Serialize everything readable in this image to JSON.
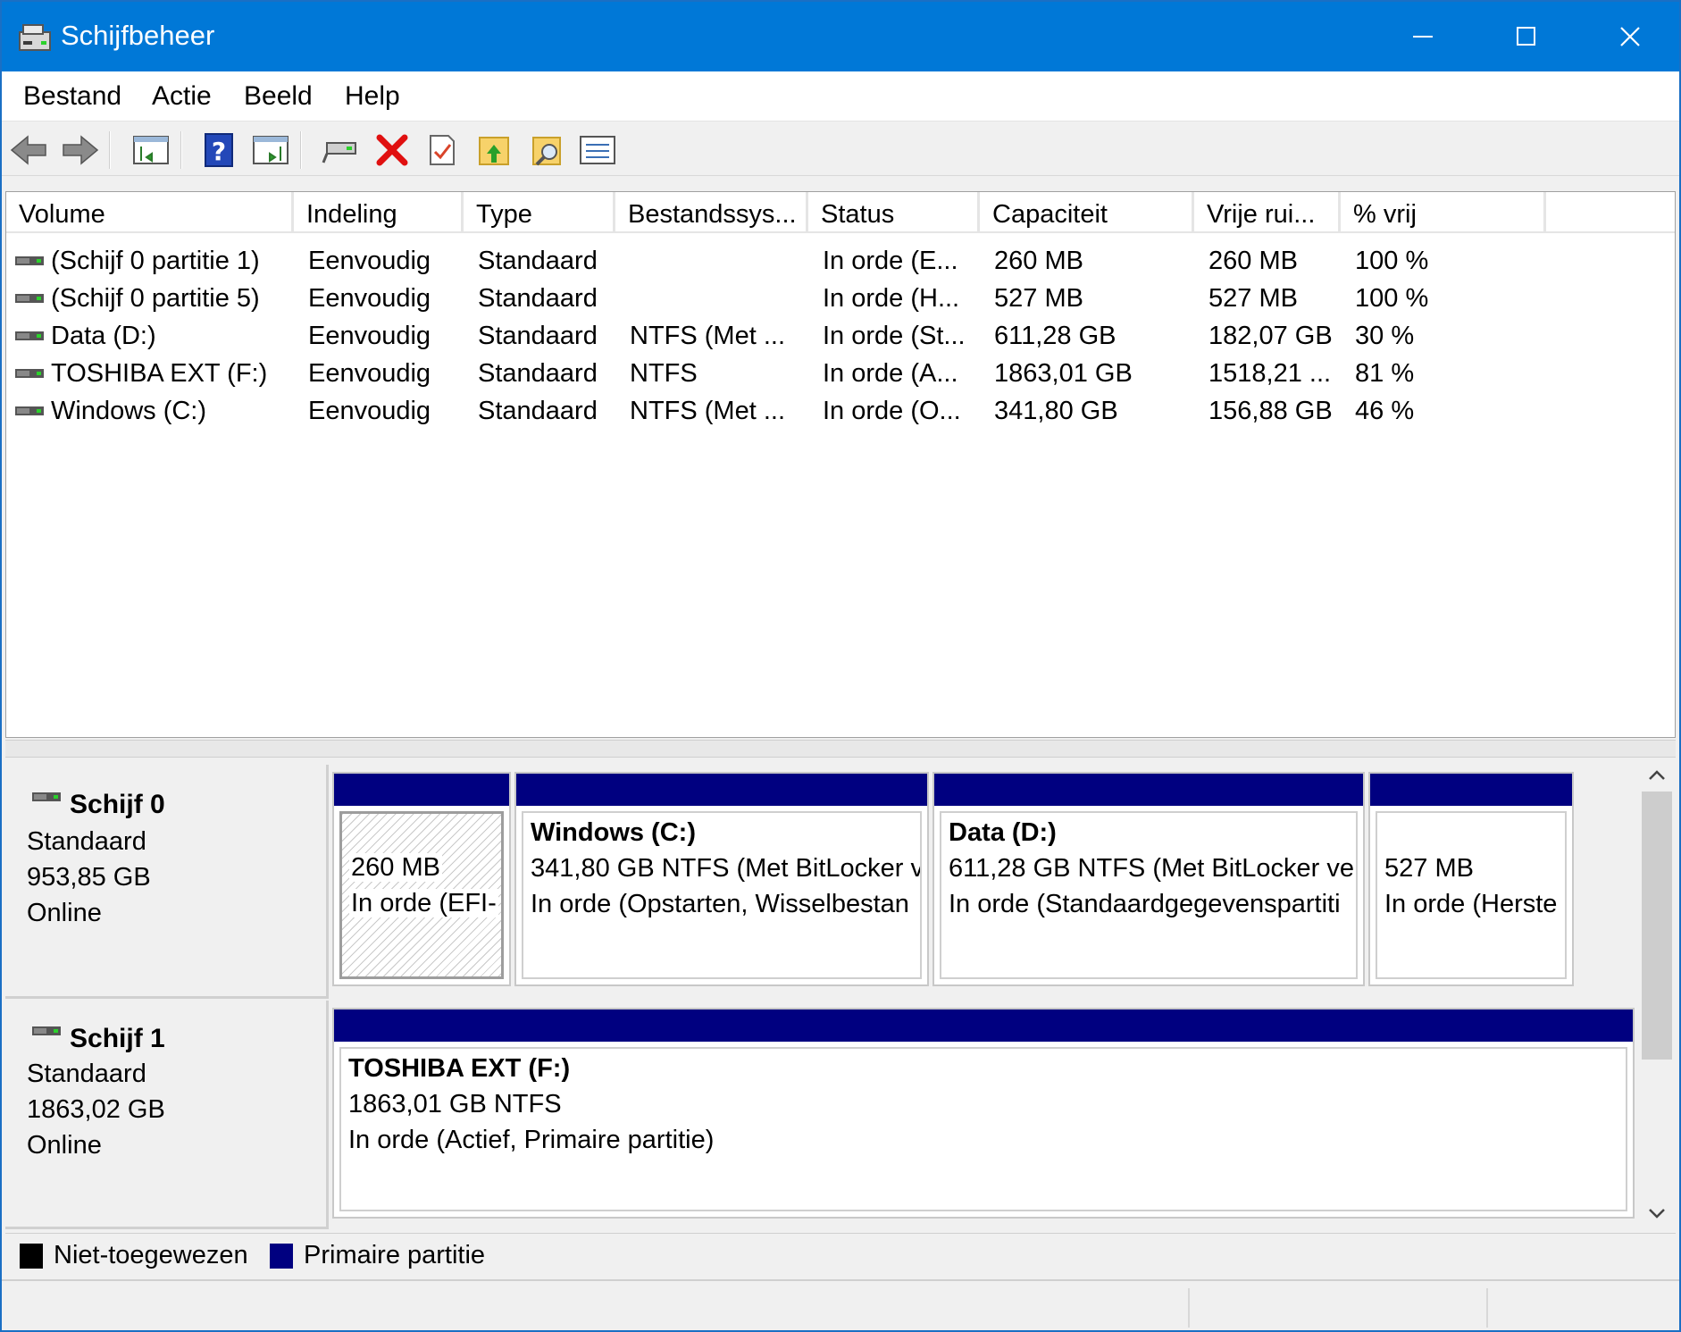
{
  "window": {
    "title": "Schijfbeheer"
  },
  "menu": [
    "Bestand",
    "Actie",
    "Beeld",
    "Help"
  ],
  "toolbar": {
    "icons": [
      "back-icon",
      "forward-icon",
      "show-hide-console-tree-icon",
      "help-icon",
      "show-hide-action-pane-icon",
      "connect-drive-icon",
      "delete-icon",
      "properties-icon",
      "folder-up-icon",
      "search-folder-icon",
      "list-view-icon"
    ]
  },
  "columns": [
    "Volume",
    "Indeling",
    "Type",
    "Bestandssys...",
    "Status",
    "Capaciteit",
    "Vrije rui...",
    "% vrij"
  ],
  "volumes": [
    {
      "volume": "(Schijf 0 partitie 1)",
      "layout": "Eenvoudig",
      "type": "Standaard",
      "fs": "",
      "status": "In orde (E...",
      "capacity": "260 MB",
      "free": "260 MB",
      "pct": "100 %"
    },
    {
      "volume": "(Schijf 0 partitie 5)",
      "layout": "Eenvoudig",
      "type": "Standaard",
      "fs": "",
      "status": "In orde (H...",
      "capacity": "527 MB",
      "free": "527 MB",
      "pct": "100 %"
    },
    {
      "volume": "Data (D:)",
      "layout": "Eenvoudig",
      "type": "Standaard",
      "fs": "NTFS (Met ...",
      "status": "In orde (St...",
      "capacity": "611,28 GB",
      "free": "182,07 GB",
      "pct": "30 %"
    },
    {
      "volume": "TOSHIBA EXT (F:)",
      "layout": "Eenvoudig",
      "type": "Standaard",
      "fs": "NTFS",
      "status": "In orde (A...",
      "capacity": "1863,01 GB",
      "free": "1518,21 ...",
      "pct": "81 %"
    },
    {
      "volume": "Windows (C:)",
      "layout": "Eenvoudig",
      "type": "Standaard",
      "fs": "NTFS (Met ...",
      "status": "In orde (O...",
      "capacity": "341,80 GB",
      "free": "156,88 GB",
      "pct": "46 %"
    }
  ],
  "disks": [
    {
      "name": "Schijf 0",
      "type": "Standaard",
      "size": "953,85 GB",
      "state": "Online",
      "partitions": [
        {
          "title": "",
          "line1": "260 MB",
          "line2": "In orde (EFI-"
        },
        {
          "title": "Windows  (C:)",
          "line1": "341,80 GB NTFS (Met BitLocker v",
          "line2": "In orde (Opstarten, Wisselbestan"
        },
        {
          "title": "Data  (D:)",
          "line1": "611,28 GB NTFS (Met BitLocker ve",
          "line2": "In orde (Standaardgegevenspartiti"
        },
        {
          "title": "",
          "line1": "527 MB",
          "line2": "In orde (Herste"
        }
      ]
    },
    {
      "name": "Schijf 1",
      "type": "Standaard",
      "size": "1863,02 GB",
      "state": "Online",
      "partitions": [
        {
          "title": "TOSHIBA EXT  (F:)",
          "line1": "1863,01 GB NTFS",
          "line2": "In orde (Actief, Primaire partitie)"
        }
      ]
    }
  ],
  "legend": [
    {
      "label": "Niet-toegewezen",
      "color": "#000000"
    },
    {
      "label": "Primaire partitie",
      "color": "#000080"
    }
  ],
  "colors": {
    "titlebar": "#0078d7",
    "primary_partition": "#000080"
  }
}
